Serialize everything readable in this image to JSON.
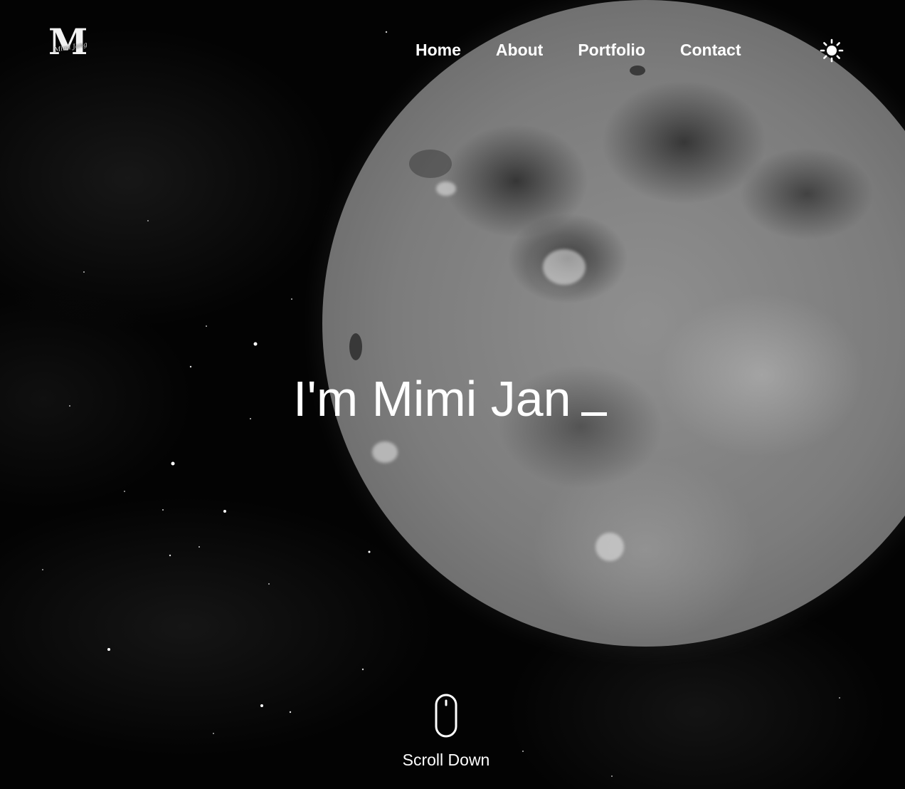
{
  "brand": {
    "logo_letter": "M",
    "logo_script": "Mimi Jang"
  },
  "nav": {
    "items": [
      {
        "label": "Home"
      },
      {
        "label": "About"
      },
      {
        "label": "Portfolio"
      },
      {
        "label": "Contact"
      }
    ]
  },
  "theme_toggle": {
    "icon": "sun-icon"
  },
  "hero": {
    "title": "I'm Mimi Jan"
  },
  "scroll": {
    "label": "Scroll Down",
    "icon": "mouse-icon"
  },
  "colors": {
    "background": "#030303",
    "text": "#ffffff"
  }
}
